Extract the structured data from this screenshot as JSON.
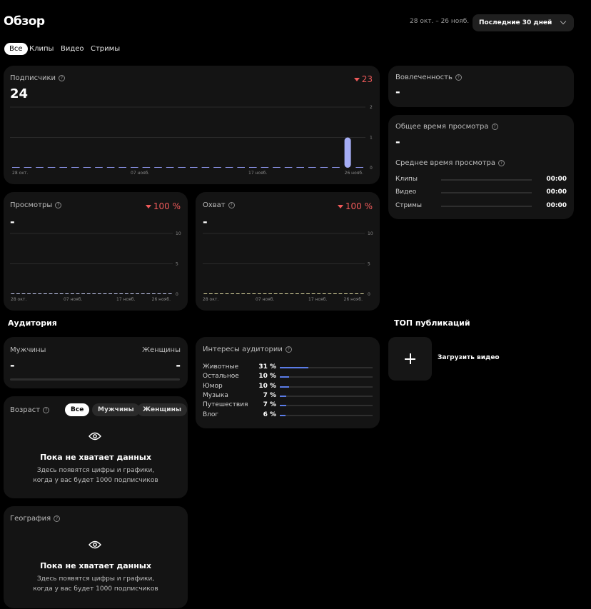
{
  "header": {
    "title": "Обзор",
    "date_range": "28 окт. – 26 нояб.",
    "period_select": "Последние 30 дней"
  },
  "tabs": [
    "Все",
    "Клипы",
    "Видео",
    "Стримы"
  ],
  "subscribers": {
    "label": "Подписчики",
    "value": "24",
    "delta": "23",
    "y_ticks": [
      "2",
      "1",
      "0"
    ],
    "x_ticks": [
      "28 окт.",
      "07 нояб.",
      "17 нояб.",
      "26 нояб."
    ]
  },
  "views": {
    "label": "Просмотры",
    "value": "-",
    "delta": "100 %",
    "y_ticks": [
      "10",
      "5",
      "0"
    ],
    "x_ticks": [
      "28 окт.",
      "07 нояб.",
      "17 нояб.",
      "26 нояб."
    ]
  },
  "reach": {
    "label": "Охват",
    "value": "-",
    "delta": "100 %",
    "y_ticks": [
      "10",
      "5",
      "0"
    ],
    "x_ticks": [
      "28 окт.",
      "07 нояб.",
      "17 нояб.",
      "26 нояб."
    ]
  },
  "engagement": {
    "label": "Вовлеченность",
    "value": "-"
  },
  "watch_time": {
    "label": "Общее время просмотра",
    "value": "-",
    "avg_label": "Среднее время просмотра",
    "rows": [
      {
        "name": "Клипы",
        "value": "00:00"
      },
      {
        "name": "Видео",
        "value": "00:00"
      },
      {
        "name": "Стримы",
        "value": "00:00"
      }
    ]
  },
  "audience": {
    "heading": "Аудитория",
    "gender": {
      "male_label": "Мужчины",
      "female_label": "Женщины",
      "male_value": "-",
      "female_value": "-"
    },
    "age": {
      "label": "Возраст",
      "filters": [
        "Все",
        "Мужчины",
        "Женщины"
      ],
      "empty_title": "Пока не хватает данных",
      "empty_line1": "Здесь появятся цифры и графики,",
      "empty_line2": "когда у вас будет 1000 подписчиков"
    },
    "geo": {
      "label": "География",
      "empty_title": "Пока не хватает данных",
      "empty_line1": "Здесь появятся цифры и графики,",
      "empty_line2": "когда у вас будет 1000 подписчиков"
    }
  },
  "interests": {
    "label": "Интересы аудитории",
    "items": [
      {
        "name": "Животные",
        "pct_text": "31 %",
        "pct": 31
      },
      {
        "name": "Остальное",
        "pct_text": "10 %",
        "pct": 10
      },
      {
        "name": "Юмор",
        "pct_text": "10 %",
        "pct": 10
      },
      {
        "name": "Музыка",
        "pct_text": "7 %",
        "pct": 7
      },
      {
        "name": "Путешествия",
        "pct_text": "7 %",
        "pct": 7
      },
      {
        "name": "Влог",
        "pct_text": "6 %",
        "pct": 6
      }
    ]
  },
  "top": {
    "heading": "ТОП публикаций",
    "upload_label": "Загрузить видео"
  },
  "chart_data": [
    {
      "type": "bar",
      "title": "Подписчики",
      "x_ticks": [
        "28 окт.",
        "07 нояб.",
        "17 нояб.",
        "26 нояб."
      ],
      "ylim": [
        0,
        2
      ],
      "values": [
        0,
        0,
        0,
        0,
        0,
        0,
        0,
        0,
        0,
        0,
        0,
        0,
        0,
        0,
        0,
        0,
        0,
        0,
        0,
        0,
        0,
        0,
        0,
        0,
        0,
        0,
        0,
        0,
        1,
        0
      ],
      "bar_color": "#a5adf5"
    },
    {
      "type": "line",
      "title": "Просмотры",
      "x_ticks": [
        "28 окт.",
        "07 нояб.",
        "17 нояб.",
        "26 нояб."
      ],
      "ylim": [
        0,
        10
      ],
      "values": [
        0,
        0,
        0,
        0,
        0,
        0,
        0,
        0,
        0,
        0,
        0,
        0,
        0,
        0,
        0,
        0,
        0,
        0,
        0,
        0,
        0,
        0,
        0,
        0,
        0,
        0,
        0,
        0,
        0,
        0
      ]
    },
    {
      "type": "line",
      "title": "Охват",
      "x_ticks": [
        "28 окт.",
        "07 нояб.",
        "17 нояб.",
        "26 нояб."
      ],
      "ylim": [
        0,
        10
      ],
      "values": [
        0,
        0,
        0,
        0,
        0,
        0,
        0,
        0,
        0,
        0,
        0,
        0,
        0,
        0,
        0,
        0,
        0,
        0,
        0,
        0,
        0,
        0,
        0,
        0,
        0,
        0,
        0,
        0,
        0,
        0
      ]
    }
  ]
}
